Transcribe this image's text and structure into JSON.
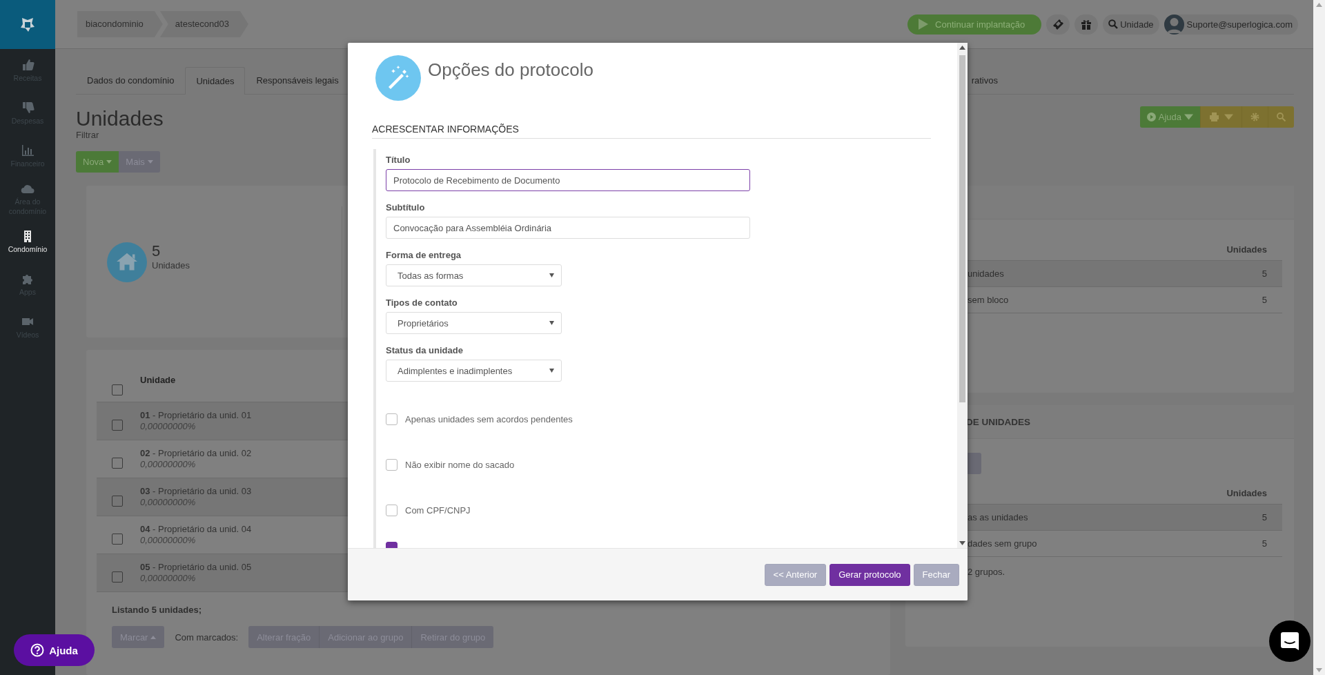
{
  "sidebar": {
    "items": [
      {
        "label": "Receitas",
        "kind": "thumb-up",
        "selected": false
      },
      {
        "label": "Despesas",
        "kind": "thumb-down",
        "selected": false
      },
      {
        "label": "Financeiro",
        "kind": "chart",
        "selected": false
      },
      {
        "label": "Área do condomínio",
        "kind": "cloud",
        "selected": false
      },
      {
        "label": "Condomínio",
        "kind": "building",
        "selected": true
      },
      {
        "label": "Apps",
        "kind": "puzzle",
        "selected": false
      },
      {
        "label": "Vídeos",
        "kind": "camera",
        "selected": false
      }
    ]
  },
  "breadcrumbs": [
    "biacondominio",
    "atestecond03"
  ],
  "topbar": {
    "cta": "Continuar implantação",
    "search_label": "Unidade",
    "user": "Suporte@superlogica.com"
  },
  "tabs": [
    {
      "label": "Dados do condomínio",
      "selected": false
    },
    {
      "label": "Unidades",
      "selected": true
    },
    {
      "label": "Responsáveis legais",
      "selected": false
    },
    {
      "label": "rativos",
      "selected": false
    }
  ],
  "page": {
    "title": "Unidades",
    "filter": "Filtrar",
    "buttons": [
      "Nova",
      "Mais"
    ],
    "help": "Ajuda"
  },
  "summary": {
    "count": "5",
    "label": "Unidades"
  },
  "units_table": {
    "header": "Unidade",
    "rows": [
      {
        "code": "01",
        "owner": "- Proprietário da unid. 01",
        "fraction": "0,00000000%",
        "checked": false
      },
      {
        "code": "02",
        "owner": "- Proprietário da unid. 02",
        "fraction": "0,00000000%",
        "checked": false
      },
      {
        "code": "03",
        "owner": "- Proprietário da unid. 03",
        "fraction": "0,00000000%",
        "checked": false
      },
      {
        "code": "04",
        "owner": "- Proprietário da unid. 04",
        "fraction": "0,00000000%",
        "checked": false
      },
      {
        "code": "05",
        "owner": "- Proprietário da unid. 05",
        "fraction": "0,00000000%",
        "checked": false
      }
    ],
    "all_checked": false,
    "footer": "Listando 5 unidades;",
    "mark_button": "Marcar",
    "with_marked": "Com marcados:",
    "actions": [
      "Alterar fração",
      "Adicionar ao grupo",
      "Retirar do grupo"
    ]
  },
  "blocks_card": {
    "column": "Unidades",
    "rows": [
      {
        "name": "unidades",
        "count": "5"
      },
      {
        "name": "sem bloco",
        "count": "5"
      }
    ]
  },
  "groups_card": {
    "title": "DE UNIDADES",
    "column": "Unidades",
    "rows": [
      {
        "name": "as as unidades",
        "count": "5"
      },
      {
        "name": "dades sem grupo",
        "count": "5"
      }
    ],
    "footer": "2 grupos."
  },
  "help_button": "Ajuda",
  "modal": {
    "title": "Opções do protocolo",
    "section": "ACRESCENTAR INFORMAÇÕES",
    "fields": [
      {
        "kind": "text",
        "label": "Título",
        "value": "Protocolo de Recebimento de Documento",
        "focused": true
      },
      {
        "kind": "text",
        "label": "Subtítulo",
        "value": "Convocação para Assembléia Ordinária",
        "focused": false
      },
      {
        "kind": "select",
        "label": "Forma de entrega",
        "value": "Todas as formas"
      },
      {
        "kind": "select",
        "label": "Tipos de contato",
        "value": "Proprietários"
      },
      {
        "kind": "select",
        "label": "Status da unidade",
        "value": "Adimplentes e inadimplentes"
      },
      {
        "kind": "checkbox",
        "label": "Apenas unidades sem acordos pendentes",
        "checked": false
      },
      {
        "kind": "checkbox",
        "label": "Não exibir nome do sacado",
        "checked": false
      },
      {
        "kind": "checkbox",
        "label": "Com CPF/CNPJ",
        "checked": false
      },
      {
        "kind": "checkbox",
        "checked": true
      }
    ],
    "buttons": [
      {
        "label": "<< Anterior",
        "disabled": true
      },
      {
        "label": "Gerar protocolo",
        "disabled": false
      },
      {
        "label": "Fechar",
        "disabled": true
      }
    ]
  }
}
